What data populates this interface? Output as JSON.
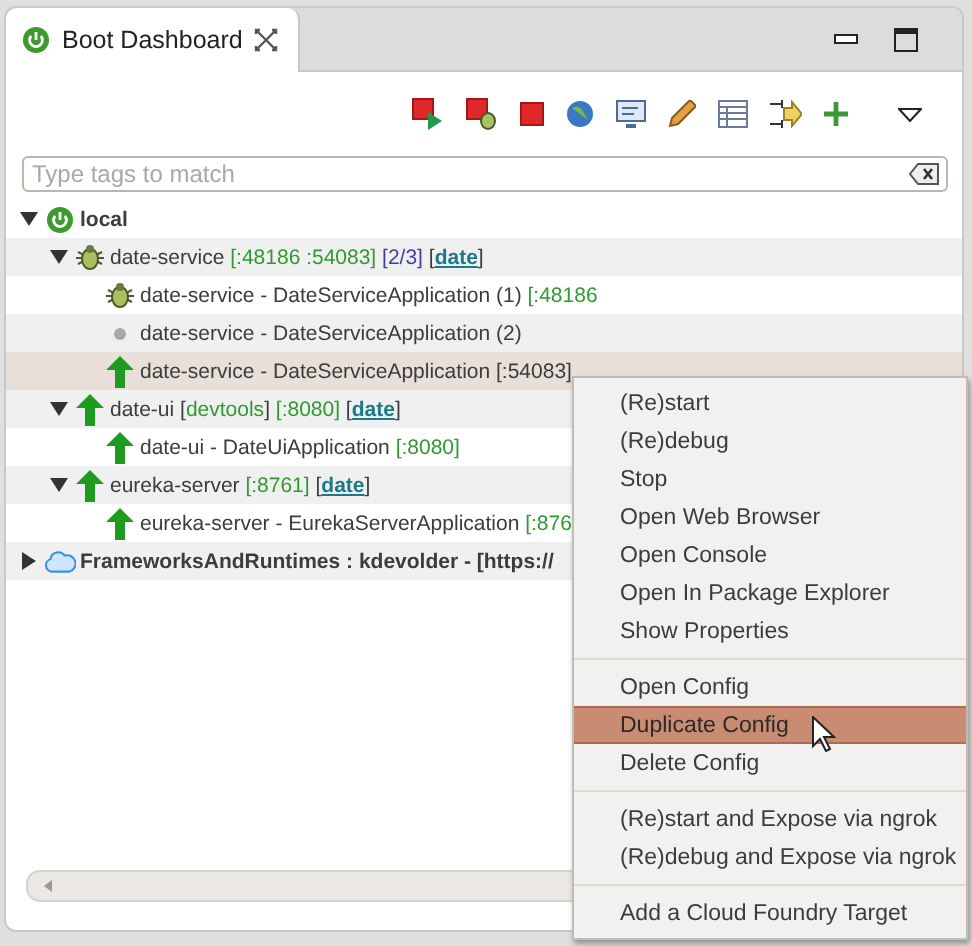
{
  "view_tab": {
    "title": "Boot Dashboard",
    "selected": true
  },
  "filter": {
    "placeholder": "Type tags to match"
  },
  "tree": [
    {
      "kind": "local",
      "expanded": true,
      "selected": false,
      "segments": [
        {
          "kind": "name",
          "text": "local"
        }
      ],
      "children": [
        {
          "kind": "debugging",
          "expanded": true,
          "selected": false,
          "segments": [
            {
              "kind": "name",
              "text": "date-service"
            },
            {
              "kind": "port",
              "text": " [:48186 :54083]"
            },
            {
              "kind": "count",
              "text": " [2/3]"
            },
            {
              "kind": "name",
              "text": " ["
            },
            {
              "kind": "tag",
              "text": "date"
            },
            {
              "kind": "name",
              "text": "]"
            }
          ],
          "children": [
            {
              "kind": "debugging",
              "selected": false,
              "segments": [
                {
                  "kind": "name",
                  "text": "date-service - DateServiceApplication (1)"
                },
                {
                  "kind": "port",
                  "text": " [:48186"
                }
              ]
            },
            {
              "kind": "inactive",
              "selected": false,
              "segments": [
                {
                  "kind": "name",
                  "text": "date-service - DateServiceApplication (2)"
                }
              ]
            },
            {
              "kind": "running",
              "selected": true,
              "segments": [
                {
                  "kind": "name",
                  "text": "date-service - DateServiceApplication [:54083]"
                }
              ]
            }
          ]
        },
        {
          "kind": "running",
          "expanded": true,
          "selected": false,
          "segments": [
            {
              "kind": "name",
              "text": "date-ui ["
            },
            {
              "kind": "port",
              "text": "devtools"
            },
            {
              "kind": "name",
              "text": "]"
            },
            {
              "kind": "port",
              "text": " [:8080]"
            },
            {
              "kind": "name",
              "text": " ["
            },
            {
              "kind": "tag",
              "text": "date"
            },
            {
              "kind": "name",
              "text": "]"
            }
          ],
          "children": [
            {
              "kind": "running",
              "selected": false,
              "segments": [
                {
                  "kind": "name",
                  "text": "date-ui - DateUiApplication"
                },
                {
                  "kind": "port",
                  "text": " [:8080]"
                }
              ]
            }
          ]
        },
        {
          "kind": "running",
          "expanded": true,
          "selected": false,
          "segments": [
            {
              "kind": "name",
              "text": "eureka-server"
            },
            {
              "kind": "port",
              "text": " [:8761]"
            },
            {
              "kind": "name",
              "text": " ["
            },
            {
              "kind": "tag",
              "text": "date"
            },
            {
              "kind": "name",
              "text": "]"
            }
          ],
          "children": [
            {
              "kind": "running",
              "selected": false,
              "segments": [
                {
                  "kind": "name",
                  "text": "eureka-server - EurekaServerApplication"
                },
                {
                  "kind": "port",
                  "text": " [:876"
                }
              ]
            }
          ]
        }
      ]
    },
    {
      "kind": "cloud",
      "expanded": false,
      "selected": false,
      "segments": [
        {
          "kind": "name",
          "text": "FrameworksAndRuntimes : kdevolder - [https://"
        }
      ]
    }
  ],
  "context_menu": [
    [
      {
        "label": "(Re)start",
        "selected": false
      },
      {
        "label": "(Re)debug",
        "selected": false
      },
      {
        "label": "Stop",
        "selected": false
      },
      {
        "label": "Open Web Browser",
        "selected": false
      },
      {
        "label": "Open Console",
        "selected": false
      },
      {
        "label": "Open In Package Explorer",
        "selected": false
      },
      {
        "label": "Show Properties",
        "selected": false
      }
    ],
    [
      {
        "label": "Open Config",
        "selected": false
      },
      {
        "label": "Duplicate Config",
        "selected": true
      },
      {
        "label": "Delete Config",
        "selected": false
      }
    ],
    [
      {
        "label": "(Re)start and Expose via ngrok",
        "selected": false
      },
      {
        "label": "(Re)debug and Expose via ngrok",
        "selected": false
      }
    ],
    [
      {
        "label": "Add a Cloud Foundry Target",
        "selected": false
      }
    ]
  ]
}
